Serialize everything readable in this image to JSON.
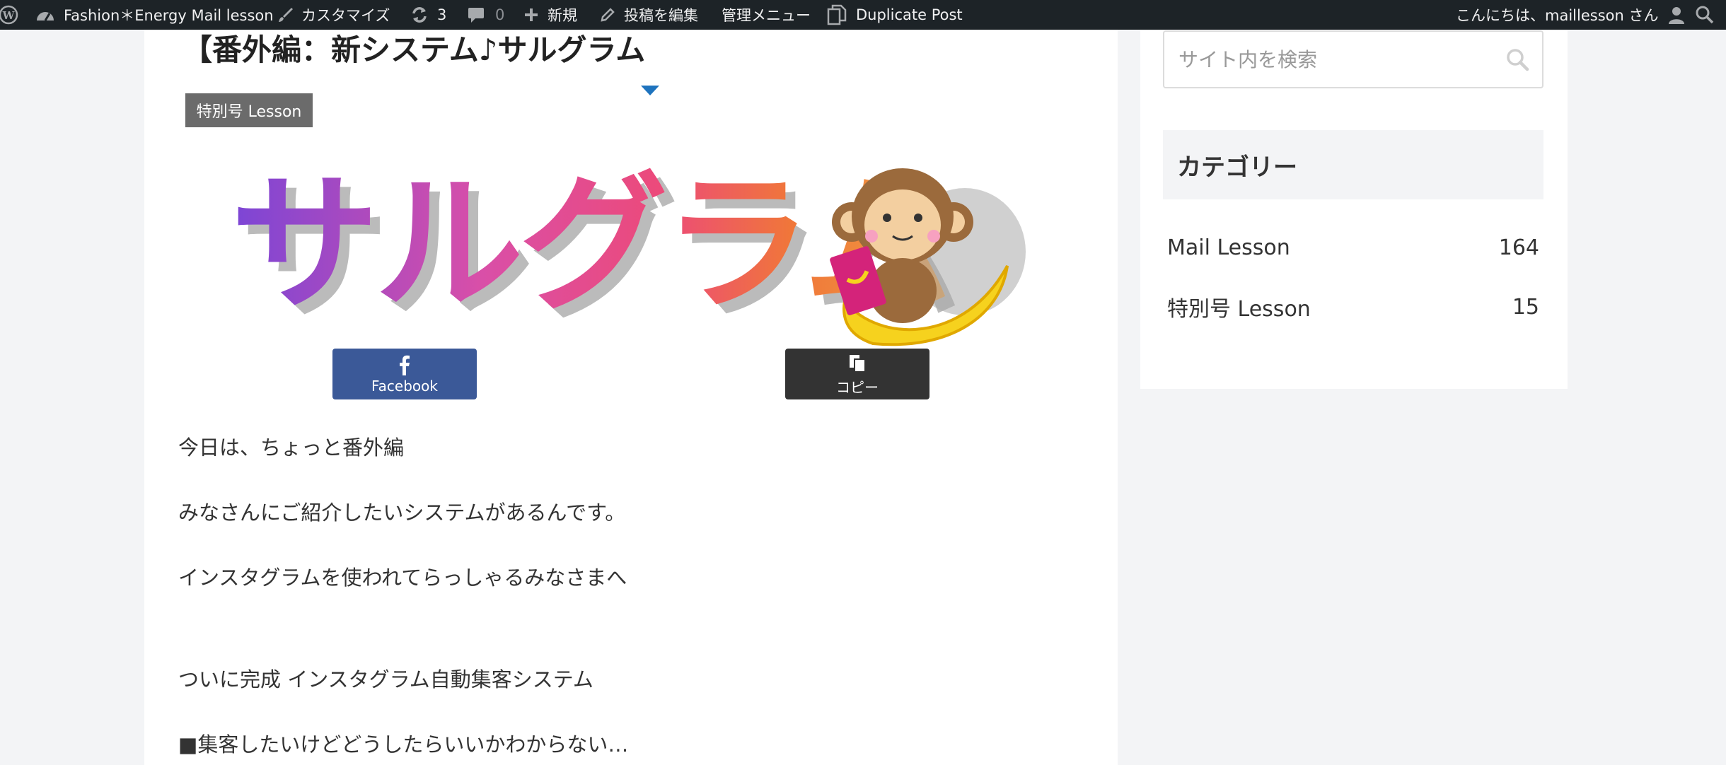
{
  "adminbar": {
    "site_name": "Fashion＊Energy Mail lesson",
    "customize": "カスタマイズ",
    "updates_count": "3",
    "comments_count": "0",
    "new_label": "新規",
    "edit_post": "投稿を編集",
    "admin_menu": "管理メニュー",
    "duplicate_post": "Duplicate Post",
    "greeting": "こんにちは、maillesson さん"
  },
  "post": {
    "title": "【番外編：新システム♪サルグラム",
    "category_badge": "特別号 Lesson",
    "eyecatch_text": "サルグラム",
    "share": {
      "facebook_label": "Facebook",
      "copy_label": "コピー"
    },
    "paragraphs": [
      "今日は、ちょっと番外編",
      "みなさんにご紹介したいシステムがあるんです。",
      "インスタグラムを使われてらっしゃるみなさまへ",
      "ついに完成 インスタグラム自動集客システム",
      "■集客したいけどどうしたらいいかわからない…"
    ]
  },
  "sidebar": {
    "search_placeholder": "サイト内を検索",
    "category_heading": "カテゴリー",
    "categories": [
      {
        "name": "Mail Lesson",
        "count": "164"
      },
      {
        "name": "特別号 Lesson",
        "count": "15"
      }
    ]
  },
  "colors": {
    "adminbar_bg": "#1d2327",
    "facebook": "#3b5998",
    "copy_button": "#333333",
    "badge": "#6b6b6b",
    "toc_arrow": "#1e73be"
  }
}
